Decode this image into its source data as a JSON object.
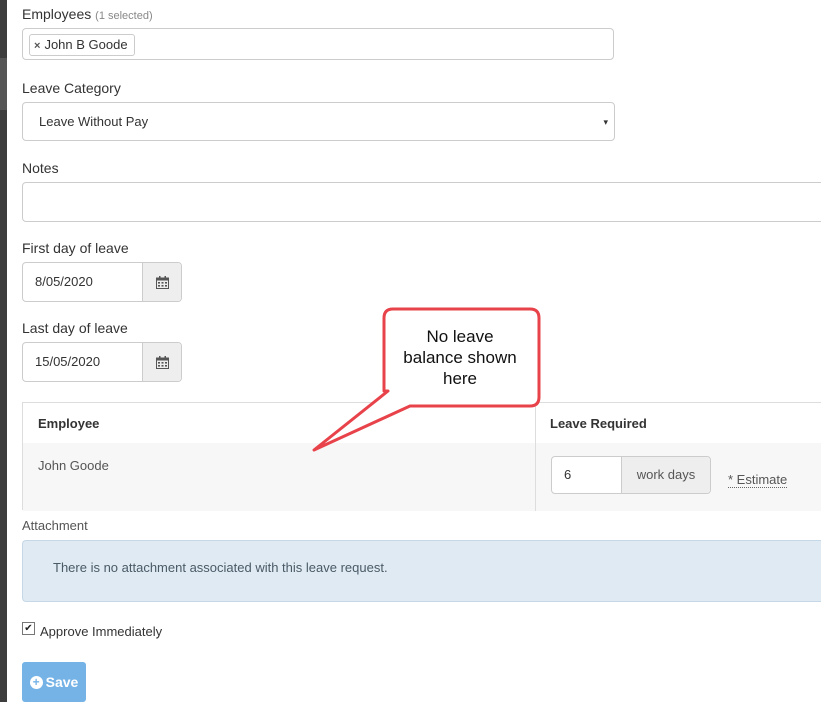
{
  "employees": {
    "label": "Employees",
    "selected_count": "(1 selected)",
    "chip_remove": "×",
    "selected_name": "John B Goode"
  },
  "leave_category": {
    "label": "Leave Category",
    "value": "Leave Without Pay",
    "caret": "▾"
  },
  "notes": {
    "label": "Notes",
    "value": ""
  },
  "first_day": {
    "label": "First day of leave",
    "value": "8/05/2020"
  },
  "last_day": {
    "label": "Last day of leave",
    "value": "15/05/2020"
  },
  "table": {
    "headers": {
      "employee": "Employee",
      "leave_required": "Leave Required"
    },
    "row": {
      "employee": "John Goode",
      "days": "6",
      "unit": "work days",
      "estimate": "* Estimate"
    }
  },
  "attachment": {
    "label": "Attachment",
    "message": "There is no attachment associated with this leave request."
  },
  "approve": {
    "label": "Approve Immediately",
    "checked": true,
    "check_glyph": "✔"
  },
  "save": {
    "label": "Save",
    "icon_glyph": "+"
  },
  "callout": {
    "lines": [
      "No leave",
      "balance shown",
      "here"
    ]
  },
  "colors": {
    "save_button": "#75b3e6",
    "callout_border": "#e8434a",
    "attachment_bg": "#dfeaf3"
  },
  "icons": {
    "calendar": "calendar-icon",
    "remove": "close-icon",
    "save": "plus-circle-icon"
  }
}
